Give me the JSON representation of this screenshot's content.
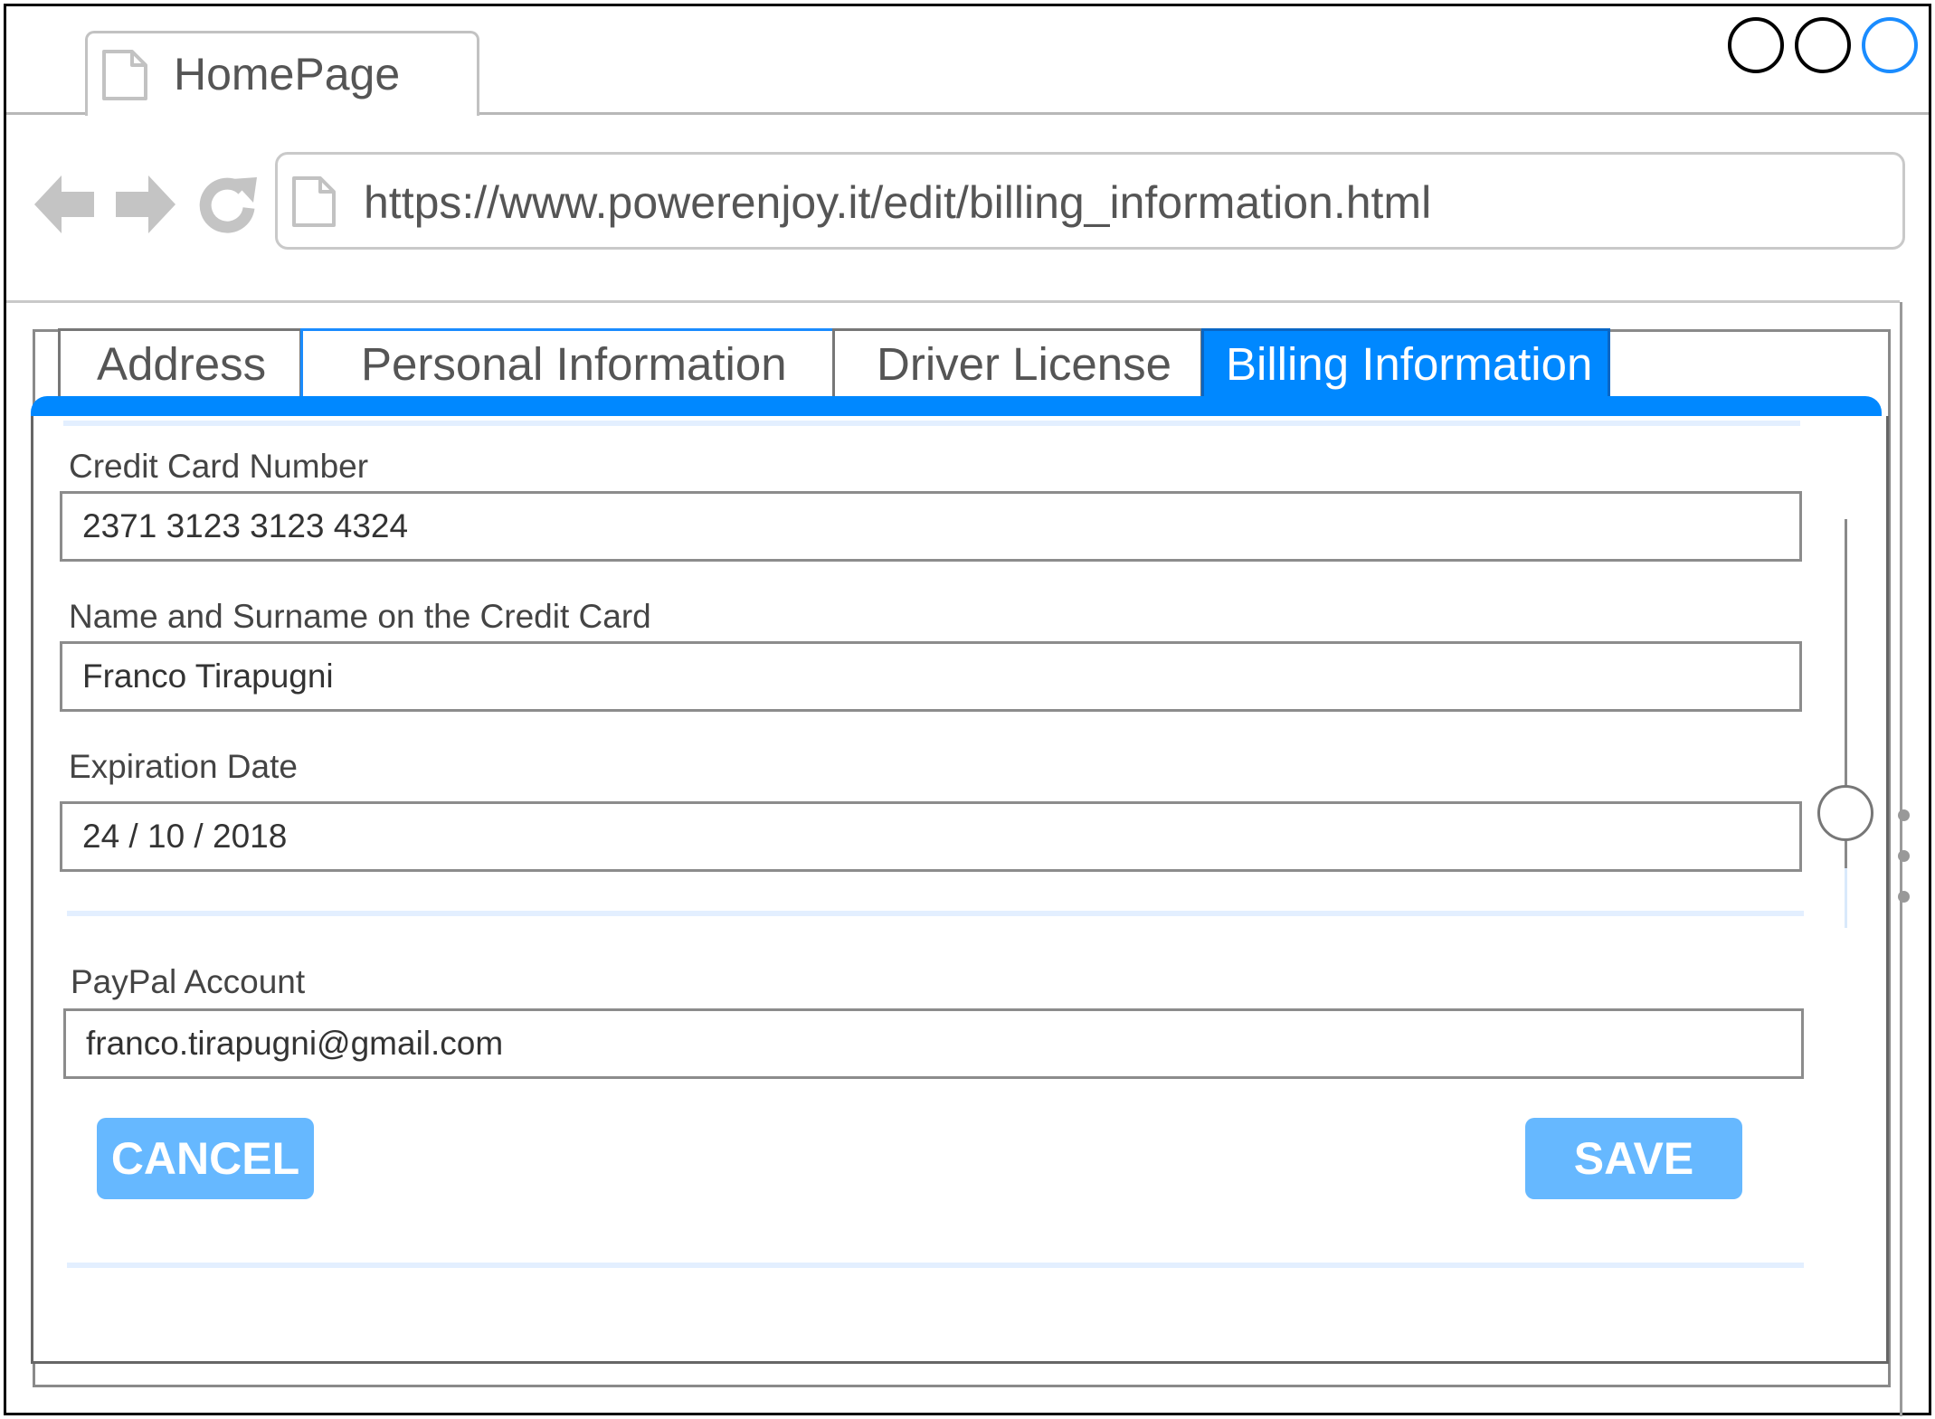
{
  "browser": {
    "tab_title": "HomePage",
    "url": "https://www.powerenjoy.it/edit/billing_information.html",
    "window_controls": [
      "circle",
      "circle",
      "circle-accent"
    ],
    "nav_icons": [
      "back-arrow-icon",
      "forward-arrow-icon",
      "reload-icon"
    ]
  },
  "tabs": [
    {
      "label": "Address",
      "active": false
    },
    {
      "label": "Personal Information",
      "active": false
    },
    {
      "label": "Driver License",
      "active": false
    },
    {
      "label": "Billing Information",
      "active": true
    }
  ],
  "form": {
    "credit_card_number": {
      "label": "Credit Card Number",
      "value": "2371 3123 3123 4324"
    },
    "card_holder": {
      "label": "Name and Surname on the Credit Card",
      "value": "Franco Tirapugni"
    },
    "expiration_date": {
      "label": "Expiration Date",
      "value": "24 / 10 / 2018"
    },
    "paypal": {
      "label": "PayPal Account",
      "value": "franco.tirapugni@gmail.com"
    }
  },
  "actions": {
    "cancel_label": "CANCEL",
    "save_label": "SAVE"
  },
  "scroll": {
    "position": 0.72
  },
  "colors": {
    "accent": "#0088ff",
    "button": "#66b8ff",
    "separator": "#e3efff",
    "text": "#555555"
  }
}
